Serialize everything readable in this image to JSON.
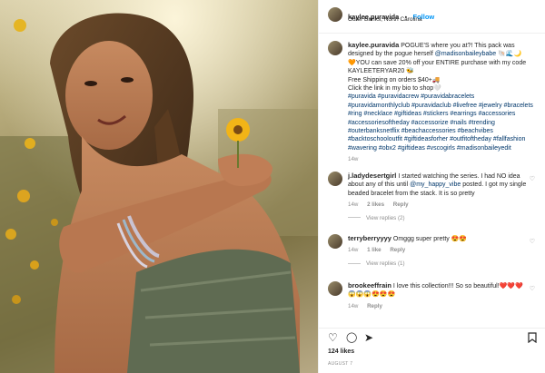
{
  "header": {
    "username": "kaylee.puravida",
    "separator": "•",
    "follow_label": "Follow",
    "location": "Outer Banks, North Carolina"
  },
  "caption": {
    "username": "kaylee.puravida",
    "text_1": "POGUE'S where you at?! This pack was designed by the pogue herself ",
    "mention": "@madisonbaileybabe",
    "emoji_1": "🐚🌊🌙",
    "text_2": "🧡YOU can save 20% off your ENTIRE purchase with my code KAYLEETERYAR20 🐝",
    "text_3": "Free Shipping on orders $40+🚚",
    "text_4": "Click the link in my bio to shop🤍",
    "hashtags": "#puravida #puravidacrew #puravidabracelets #puravidamonthlyclub #puravidaclub #livefree #jewelry #bracelets #ring #necklace #giftideas #stickers #earrings #accessories #accessoriesoftheday #accessorize #nails #trending #outerbanksnetflix #beachaccessories #beachvibes #backtoschooloutfit #giftideasforher #outfitoftheday #fallfashion #wavering #obx2 #giftideas #vscogirls #madisonbaileyedit",
    "time": "14w"
  },
  "comments": [
    {
      "username": "j.ladydesertgirl",
      "text_1": "I started watching the series. I had NO idea about any of this until ",
      "mention": "@my_happy_vibe",
      "text_2": " posted. I got my single beaded bracelet from the stack. It is so pretty",
      "time": "14w",
      "likes": "2 likes",
      "reply": "Reply",
      "view_replies": "View replies (2)"
    },
    {
      "username": "terryberryyyy",
      "text_1": "Omggg super pretty 😍😍",
      "time": "14w",
      "likes": "1 like",
      "reply": "Reply",
      "view_replies": "View replies (1)"
    },
    {
      "username": "brookeeffrain",
      "text_1": "I love this collection!!! So so beautiful!❤️❤️❤️",
      "text_2": "😱😱😱😍😍😍",
      "time": "14w",
      "reply": "Reply"
    }
  ],
  "actions": {
    "like_icon": "heart-icon",
    "comment_icon": "comment-icon",
    "share_icon": "share-icon",
    "save_icon": "bookmark-icon"
  },
  "likes_count": "124 likes",
  "post_date": "AUGUST 7",
  "colors": {
    "link": "#00376b",
    "follow": "#0095f6",
    "muted": "#8e8e8e",
    "text": "#262626"
  }
}
